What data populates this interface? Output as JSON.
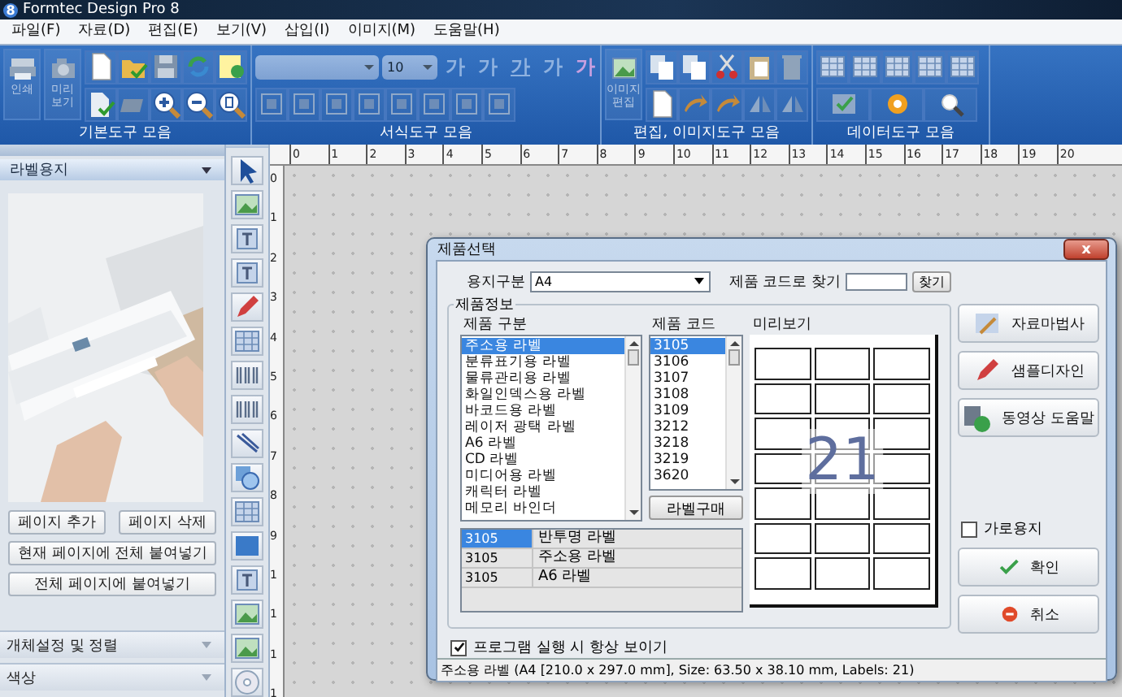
{
  "window": {
    "title": "Formtec Design Pro 8",
    "app_icon": "8"
  },
  "menu": [
    "파일(F)",
    "자료(D)",
    "편집(E)",
    "보기(V)",
    "삽입(I)",
    "이미지(M)",
    "도움말(H)"
  ],
  "toolbar": {
    "groups": [
      {
        "kind": "basic",
        "label": "기본도구 모음",
        "buttons": [
          [
            "인쇄"
          ],
          [
            "미리",
            "보기"
          ]
        ]
      },
      {
        "kind": "format",
        "label": "서식도구 모음",
        "font_size": "10",
        "glyphs": [
          "가",
          "가",
          "가",
          "가",
          "가"
        ]
      },
      {
        "kind": "edit",
        "label": "편집, 이미지도구 모음",
        "buttons": [
          [
            "이미지",
            "편집"
          ]
        ]
      },
      {
        "kind": "data",
        "label": "데이터도구 모음"
      }
    ]
  },
  "left_panel": {
    "header": "라벨용지",
    "picture": {
      "kind": "picture"
    },
    "buttons": [
      [
        "페이지 추가",
        "페이지 삭제"
      ],
      [
        "현재 페이지에 전체 붙여넣기"
      ],
      [
        "전체 페이지에 붙여넣기"
      ]
    ],
    "sections": [
      "개체설정 및 정렬",
      "색상"
    ]
  },
  "rulers": {
    "horizontal": [
      "0",
      "1",
      "2",
      "3",
      "4",
      "5",
      "6",
      "7",
      "8",
      "9",
      "10",
      "11",
      "12",
      "13",
      "14",
      "15",
      "16",
      "17",
      "18",
      "19",
      "20"
    ],
    "vertical": [
      "0",
      "1",
      "2",
      "3",
      "4",
      "5",
      "6",
      "7",
      "8",
      "9",
      "1",
      "1",
      "1",
      "1"
    ]
  },
  "dialog": {
    "title": "제품선택",
    "close": "x",
    "paper_label": "용지구분",
    "paper_value": "A4",
    "find_label": "제품 코드로 찾기",
    "find_button": "찾기",
    "group_title": "제품정보",
    "col_category": "제품 구분",
    "col_code": "제품 코드",
    "col_preview": "미리보기",
    "categories": [
      {
        "label": "주소용 라벨",
        "selected": true
      },
      {
        "label": "분류표기용 라벨",
        "selected": false
      },
      {
        "label": "물류관리용 라벨",
        "selected": false
      },
      {
        "label": "화일인덱스용 라벨",
        "selected": false
      },
      {
        "label": "바코드용 라벨",
        "selected": false
      },
      {
        "label": "레이저 광택 라벨",
        "selected": false
      },
      {
        "label": "A6 라벨",
        "selected": false
      },
      {
        "label": "CD 라벨",
        "selected": false
      },
      {
        "label": "미디어용 라벨",
        "selected": false
      },
      {
        "label": "캐릭터 라벨",
        "selected": false
      },
      {
        "label": "메모리 바인더",
        "selected": false
      }
    ],
    "codes": [
      {
        "label": "3105",
        "selected": true
      },
      {
        "label": "3106",
        "selected": false
      },
      {
        "label": "3107",
        "selected": false
      },
      {
        "label": "3108",
        "selected": false
      },
      {
        "label": "3109",
        "selected": false
      },
      {
        "label": "3212",
        "selected": false
      },
      {
        "label": "3218",
        "selected": false
      },
      {
        "label": "3219",
        "selected": false
      },
      {
        "label": "3620",
        "selected": false
      }
    ],
    "buy_button": "라벨구매",
    "results": [
      {
        "code": "3105",
        "name": "반투명 라벨",
        "selected": true
      },
      {
        "code": "3105",
        "name": "주소용 라벨",
        "selected": false
      },
      {
        "code": "3105",
        "name": "A6 라벨",
        "selected": false
      }
    ],
    "preview_count": "21",
    "side_buttons": [
      "자료마법사",
      "샘플디자인",
      "동영상 도움말"
    ],
    "landscape": {
      "label": "가로용지",
      "checked": false
    },
    "ok": "확인",
    "cancel": "취소",
    "always_show": {
      "label": "프로그램 실행 시 항상 보이기",
      "checked": true
    },
    "status": "주소용 라벨 (A4 [210.0 x 297.0 mm], Size: 63.50 x 38.10 mm, Labels: 21)"
  }
}
